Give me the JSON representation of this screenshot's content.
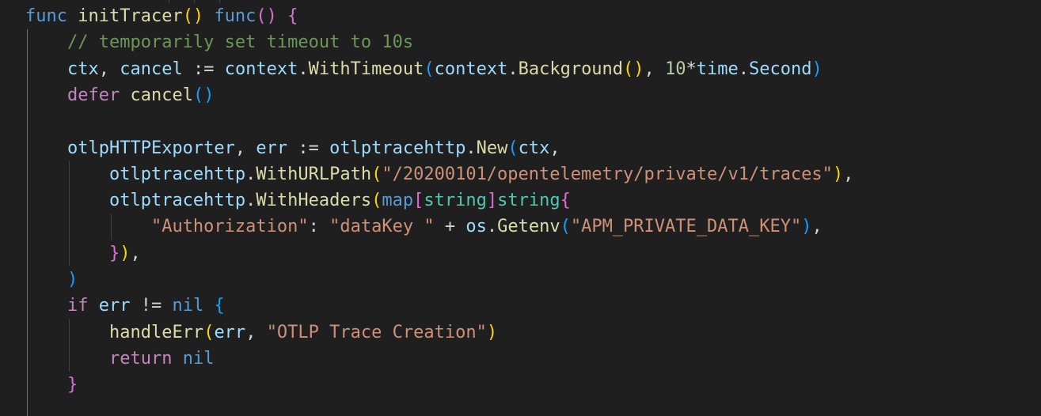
{
  "editor": {
    "lines": [
      [
        [
          "kw",
          "func"
        ],
        [
          "op",
          " "
        ],
        [
          "fn",
          "initTracer"
        ],
        [
          "b1",
          "()"
        ],
        [
          "op",
          " "
        ],
        [
          "kw",
          "func"
        ],
        [
          "b2",
          "()"
        ],
        [
          "op",
          " "
        ],
        [
          "b2",
          "{"
        ]
      ],
      [
        [
          "op",
          "    "
        ],
        [
          "cmt",
          "// temporarily set timeout to 10s"
        ]
      ],
      [
        [
          "op",
          "    "
        ],
        [
          "var",
          "ctx"
        ],
        [
          "op",
          ", "
        ],
        [
          "var",
          "cancel"
        ],
        [
          "op",
          " := "
        ],
        [
          "var",
          "context"
        ],
        [
          "op",
          "."
        ],
        [
          "fn",
          "WithTimeout"
        ],
        [
          "b3",
          "("
        ],
        [
          "var",
          "context"
        ],
        [
          "op",
          "."
        ],
        [
          "fn",
          "Background"
        ],
        [
          "b1",
          "()"
        ],
        [
          "op",
          ", "
        ],
        [
          "num",
          "10"
        ],
        [
          "op",
          "*"
        ],
        [
          "var",
          "time"
        ],
        [
          "op",
          "."
        ],
        [
          "var",
          "Second"
        ],
        [
          "b3",
          ")"
        ]
      ],
      [
        [
          "op",
          "    "
        ],
        [
          "ctrl",
          "defer"
        ],
        [
          "op",
          " "
        ],
        [
          "fn",
          "cancel"
        ],
        [
          "b3",
          "()"
        ]
      ],
      [],
      [
        [
          "op",
          "    "
        ],
        [
          "var",
          "otlpHTTPExporter"
        ],
        [
          "op",
          ", "
        ],
        [
          "var",
          "err"
        ],
        [
          "op",
          " := "
        ],
        [
          "var",
          "otlptracehttp"
        ],
        [
          "op",
          "."
        ],
        [
          "fn",
          "New"
        ],
        [
          "b3",
          "("
        ],
        [
          "var",
          "ctx"
        ],
        [
          "op",
          ","
        ]
      ],
      [
        [
          "op",
          "        "
        ],
        [
          "var",
          "otlptracehttp"
        ],
        [
          "op",
          "."
        ],
        [
          "fn",
          "WithURLPath"
        ],
        [
          "b1",
          "("
        ],
        [
          "str",
          "\"/20200101/opentelemetry/private/v1/traces\""
        ],
        [
          "b1",
          ")"
        ],
        [
          "op",
          ","
        ]
      ],
      [
        [
          "op",
          "        "
        ],
        [
          "var",
          "otlptracehttp"
        ],
        [
          "op",
          "."
        ],
        [
          "fn",
          "WithHeaders"
        ],
        [
          "b1",
          "("
        ],
        [
          "kw",
          "map"
        ],
        [
          "b2",
          "["
        ],
        [
          "type",
          "string"
        ],
        [
          "b2",
          "]"
        ],
        [
          "type",
          "string"
        ],
        [
          "b2",
          "{"
        ]
      ],
      [
        [
          "op",
          "            "
        ],
        [
          "str",
          "\"Authorization\""
        ],
        [
          "op",
          ": "
        ],
        [
          "str",
          "\"dataKey \""
        ],
        [
          "op",
          " + "
        ],
        [
          "var",
          "os"
        ],
        [
          "op",
          "."
        ],
        [
          "fn",
          "Getenv"
        ],
        [
          "b3",
          "("
        ],
        [
          "str",
          "\"APM_PRIVATE_DATA_KEY\""
        ],
        [
          "b3",
          ")"
        ],
        [
          "op",
          ","
        ]
      ],
      [
        [
          "op",
          "        "
        ],
        [
          "b2",
          "}"
        ],
        [
          "b1",
          ")"
        ],
        [
          "op",
          ","
        ]
      ],
      [
        [
          "op",
          "    "
        ],
        [
          "b3",
          ")"
        ]
      ],
      [
        [
          "op",
          "    "
        ],
        [
          "ctrl",
          "if"
        ],
        [
          "op",
          " "
        ],
        [
          "var",
          "err"
        ],
        [
          "op",
          " != "
        ],
        [
          "kw",
          "nil"
        ],
        [
          "op",
          " "
        ],
        [
          "b3",
          "{"
        ]
      ],
      [
        [
          "op",
          "        "
        ],
        [
          "fn",
          "handleErr"
        ],
        [
          "b1",
          "("
        ],
        [
          "var",
          "err"
        ],
        [
          "op",
          ", "
        ],
        [
          "str",
          "\"OTLP Trace Creation\""
        ],
        [
          "b1",
          ")"
        ]
      ],
      [
        [
          "op",
          "        "
        ],
        [
          "ctrl",
          "return"
        ],
        [
          "op",
          " "
        ],
        [
          "kw",
          "nil"
        ]
      ],
      [
        [
          "op",
          "    "
        ],
        [
          "b2",
          "}"
        ]
      ]
    ]
  }
}
